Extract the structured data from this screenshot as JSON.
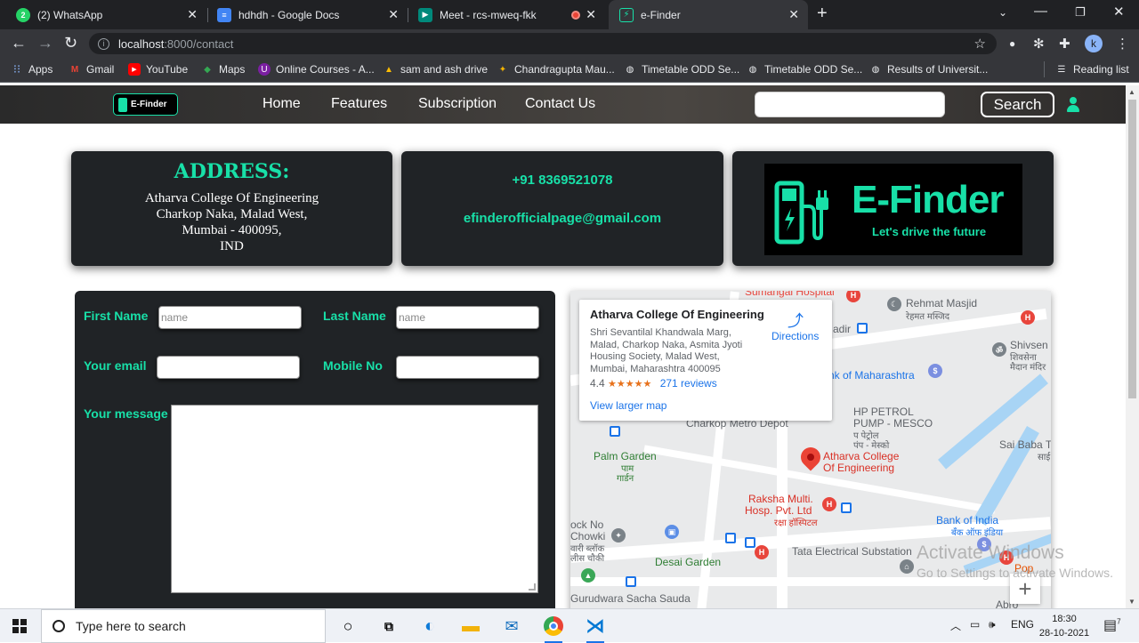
{
  "browser": {
    "tabs": [
      {
        "title": "(2) WhatsApp",
        "icon": "whatsapp-icon",
        "color": "#25d366"
      },
      {
        "title": "hdhdh - Google Docs",
        "icon": "google-docs-icon",
        "color": "#4285f4"
      },
      {
        "title": "Meet - rcs-mweq-fkk",
        "icon": "google-meet-icon",
        "color": "#00897b"
      },
      {
        "title": "e-Finder",
        "icon": "efinder-favicon",
        "color": "#18e0a8"
      }
    ],
    "url_host": "localhost",
    "url_path": ":8000/contact",
    "profile_initial": "k",
    "bookmarks": [
      {
        "label": "Apps",
        "icon": "apps-grid-icon"
      },
      {
        "label": "Gmail",
        "icon": "gmail-icon"
      },
      {
        "label": "YouTube",
        "icon": "youtube-icon"
      },
      {
        "label": "Maps",
        "icon": "maps-icon"
      },
      {
        "label": "Online Courses - A...",
        "icon": "courses-icon"
      },
      {
        "label": "sam and ash drive",
        "icon": "google-drive-icon"
      },
      {
        "label": "Chandragupta Mau...",
        "icon": "bookmark-site-icon"
      },
      {
        "label": "Timetable ODD Se...",
        "icon": "globe-icon"
      },
      {
        "label": "Timetable ODD Se...",
        "icon": "globe-icon"
      },
      {
        "label": "Results of Universit...",
        "icon": "globe-icon"
      }
    ],
    "reading_list": "Reading list"
  },
  "site": {
    "brand": "E-Finder",
    "nav": [
      "Home",
      "Features",
      "Subscription",
      "Contact Us"
    ],
    "search_button": "Search",
    "search_value": "",
    "accent": "#18e0a8",
    "card_bg": "#202326"
  },
  "address": {
    "title": "ADDRESS:",
    "lines": [
      "Atharva College Of Engineering",
      "Charkop Naka, Malad West,",
      "Mumbai - 400095,",
      "IND"
    ]
  },
  "contact": {
    "phone": "+91 8369521078",
    "email": "efinderofficialpage@gmail.com"
  },
  "logo": {
    "name": "E-Finder",
    "tagline": "Let's drive the future"
  },
  "form": {
    "first_name_label": "First Name",
    "first_name_placeholder": "name",
    "last_name_label": "Last Name",
    "last_name_placeholder": "name",
    "email_label": "Your email",
    "mobile_label": "Mobile No",
    "message_label": "Your message"
  },
  "map": {
    "place_name": "Atharva College Of Engineering",
    "address_lines": [
      "Shri Sevantilal Khandwala Marg,",
      "Malad, Charkop Naka, Asmita Jyoti",
      "Housing Society, Malad West,",
      "Mumbai, Maharashtra 400095"
    ],
    "rating": "4.4",
    "stars": "★★★★★",
    "reviews": "271 reviews",
    "directions": "Directions",
    "view_larger": "View larger map",
    "zoom_in": "+",
    "labels": {
      "hospital_top": "Sumangal Hospital",
      "masjid": "Rehmat Masjid",
      "masjid_hi": "रेहमत मस्जिद",
      "shivsena": "Shivsen",
      "shivsena_hi": "शिवसेना",
      "shivsena_hi2": "मैदान मंदिर",
      "adir": "adir",
      "bank_mh": "nk of Maharashtra",
      "hp_petrol": "HP PETROL",
      "pump": "PUMP - MESCO",
      "pump_hi": "प पेट्रोल",
      "pump_hi2": "पंप - मेस्को",
      "metro": "Charkop Metro Depot",
      "palm": "Palm Garden",
      "palm_hi": "पाम",
      "palm_hi2": "गार्डन",
      "college1": "Atharva College",
      "college2": "Of Engineering",
      "saibaba": "Sai Baba T",
      "saibaba_hi": "साई",
      "raksha1": "Raksha Multi.",
      "raksha2": "Hosp. Pvt. Ltd",
      "raksha_hi": "रक्षा हॉस्पिटल",
      "bank_india": "Bank of India",
      "bank_india_hi": "बँक ऑफ इंडिया",
      "chowki1": "ock No",
      "chowki2": "Chowki",
      "chowki_hi": "वारी ब्लॉक",
      "chowki_hi2": "लीस चौकी",
      "desai": "Desai Garden",
      "tata": "Tata Electrical Substation",
      "gurudwara": "Gurudwara Sacha Sauda",
      "pop": "Pop",
      "abro": "Abro"
    }
  },
  "watermark": {
    "line1": "Activate Windows",
    "line2": "Go to Settings to activate Windows."
  },
  "taskbar": {
    "search_placeholder": "Type here to search",
    "lang": "ENG",
    "time": "18:30",
    "date": "28-10-2021",
    "notifications": "7"
  }
}
